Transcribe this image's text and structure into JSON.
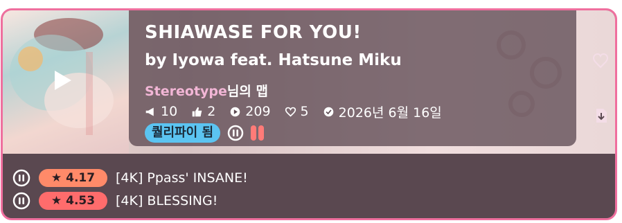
{
  "map": {
    "title": "SHIAWASE FOR YOU!",
    "artist_line": "by Iyowa feat. Hatsune Miku",
    "mapper_name": "Stereotype",
    "mapper_suffix": "님의 맵",
    "stats": {
      "bookmarks": "10",
      "upvotes": "2",
      "plays": "209",
      "favorites": "5",
      "ranked_date": "2026년 6월 16일"
    },
    "ranked_badge": "퀄리파이 됨",
    "colors": {
      "accent_pink": "#ef6f9e",
      "card_bg": "#5a4850",
      "ranked_badge": "#5bc4f1",
      "star_pill_1": "#ff8a69",
      "star_pill_2": "#ff6c6c"
    }
  },
  "difficulties": [
    {
      "stars": "4.17",
      "name": "[4K] Ppass' INSANE!",
      "pill_color": "#ff8a69"
    },
    {
      "stars": "4.53",
      "name": "[4K] BLESSING!",
      "pill_color": "#ff6c6c"
    }
  ],
  "icons": {
    "play": "play-icon",
    "heart": "heart-icon",
    "download": "download-icon",
    "bookmark": "megaphone-icon",
    "upvote": "thumbs-up-icon",
    "plays": "play-circle-icon",
    "favorite": "heart-outline-icon",
    "ranked": "check-circle-icon",
    "mode": "mania-mode-icon",
    "star": "star-icon"
  }
}
